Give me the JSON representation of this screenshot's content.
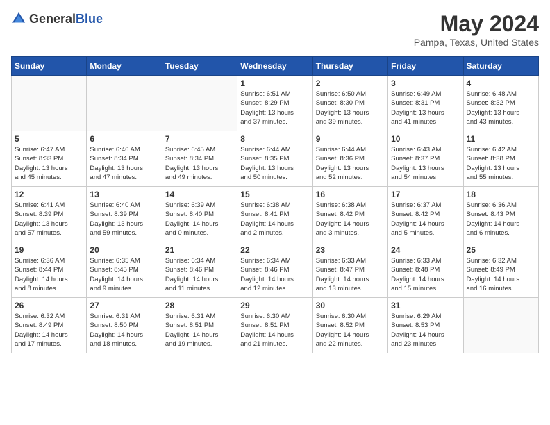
{
  "header": {
    "logo_general": "General",
    "logo_blue": "Blue",
    "month_year": "May 2024",
    "location": "Pampa, Texas, United States"
  },
  "days_of_week": [
    "Sunday",
    "Monday",
    "Tuesday",
    "Wednesday",
    "Thursday",
    "Friday",
    "Saturday"
  ],
  "weeks": [
    [
      {
        "day": "",
        "info": ""
      },
      {
        "day": "",
        "info": ""
      },
      {
        "day": "",
        "info": ""
      },
      {
        "day": "1",
        "info": "Sunrise: 6:51 AM\nSunset: 8:29 PM\nDaylight: 13 hours\nand 37 minutes."
      },
      {
        "day": "2",
        "info": "Sunrise: 6:50 AM\nSunset: 8:30 PM\nDaylight: 13 hours\nand 39 minutes."
      },
      {
        "day": "3",
        "info": "Sunrise: 6:49 AM\nSunset: 8:31 PM\nDaylight: 13 hours\nand 41 minutes."
      },
      {
        "day": "4",
        "info": "Sunrise: 6:48 AM\nSunset: 8:32 PM\nDaylight: 13 hours\nand 43 minutes."
      }
    ],
    [
      {
        "day": "5",
        "info": "Sunrise: 6:47 AM\nSunset: 8:33 PM\nDaylight: 13 hours\nand 45 minutes."
      },
      {
        "day": "6",
        "info": "Sunrise: 6:46 AM\nSunset: 8:34 PM\nDaylight: 13 hours\nand 47 minutes."
      },
      {
        "day": "7",
        "info": "Sunrise: 6:45 AM\nSunset: 8:34 PM\nDaylight: 13 hours\nand 49 minutes."
      },
      {
        "day": "8",
        "info": "Sunrise: 6:44 AM\nSunset: 8:35 PM\nDaylight: 13 hours\nand 50 minutes."
      },
      {
        "day": "9",
        "info": "Sunrise: 6:44 AM\nSunset: 8:36 PM\nDaylight: 13 hours\nand 52 minutes."
      },
      {
        "day": "10",
        "info": "Sunrise: 6:43 AM\nSunset: 8:37 PM\nDaylight: 13 hours\nand 54 minutes."
      },
      {
        "day": "11",
        "info": "Sunrise: 6:42 AM\nSunset: 8:38 PM\nDaylight: 13 hours\nand 55 minutes."
      }
    ],
    [
      {
        "day": "12",
        "info": "Sunrise: 6:41 AM\nSunset: 8:39 PM\nDaylight: 13 hours\nand 57 minutes."
      },
      {
        "day": "13",
        "info": "Sunrise: 6:40 AM\nSunset: 8:39 PM\nDaylight: 13 hours\nand 59 minutes."
      },
      {
        "day": "14",
        "info": "Sunrise: 6:39 AM\nSunset: 8:40 PM\nDaylight: 14 hours\nand 0 minutes."
      },
      {
        "day": "15",
        "info": "Sunrise: 6:38 AM\nSunset: 8:41 PM\nDaylight: 14 hours\nand 2 minutes."
      },
      {
        "day": "16",
        "info": "Sunrise: 6:38 AM\nSunset: 8:42 PM\nDaylight: 14 hours\nand 3 minutes."
      },
      {
        "day": "17",
        "info": "Sunrise: 6:37 AM\nSunset: 8:42 PM\nDaylight: 14 hours\nand 5 minutes."
      },
      {
        "day": "18",
        "info": "Sunrise: 6:36 AM\nSunset: 8:43 PM\nDaylight: 14 hours\nand 6 minutes."
      }
    ],
    [
      {
        "day": "19",
        "info": "Sunrise: 6:36 AM\nSunset: 8:44 PM\nDaylight: 14 hours\nand 8 minutes."
      },
      {
        "day": "20",
        "info": "Sunrise: 6:35 AM\nSunset: 8:45 PM\nDaylight: 14 hours\nand 9 minutes."
      },
      {
        "day": "21",
        "info": "Sunrise: 6:34 AM\nSunset: 8:46 PM\nDaylight: 14 hours\nand 11 minutes."
      },
      {
        "day": "22",
        "info": "Sunrise: 6:34 AM\nSunset: 8:46 PM\nDaylight: 14 hours\nand 12 minutes."
      },
      {
        "day": "23",
        "info": "Sunrise: 6:33 AM\nSunset: 8:47 PM\nDaylight: 14 hours\nand 13 minutes."
      },
      {
        "day": "24",
        "info": "Sunrise: 6:33 AM\nSunset: 8:48 PM\nDaylight: 14 hours\nand 15 minutes."
      },
      {
        "day": "25",
        "info": "Sunrise: 6:32 AM\nSunset: 8:49 PM\nDaylight: 14 hours\nand 16 minutes."
      }
    ],
    [
      {
        "day": "26",
        "info": "Sunrise: 6:32 AM\nSunset: 8:49 PM\nDaylight: 14 hours\nand 17 minutes."
      },
      {
        "day": "27",
        "info": "Sunrise: 6:31 AM\nSunset: 8:50 PM\nDaylight: 14 hours\nand 18 minutes."
      },
      {
        "day": "28",
        "info": "Sunrise: 6:31 AM\nSunset: 8:51 PM\nDaylight: 14 hours\nand 19 minutes."
      },
      {
        "day": "29",
        "info": "Sunrise: 6:30 AM\nSunset: 8:51 PM\nDaylight: 14 hours\nand 21 minutes."
      },
      {
        "day": "30",
        "info": "Sunrise: 6:30 AM\nSunset: 8:52 PM\nDaylight: 14 hours\nand 22 minutes."
      },
      {
        "day": "31",
        "info": "Sunrise: 6:29 AM\nSunset: 8:53 PM\nDaylight: 14 hours\nand 23 minutes."
      },
      {
        "day": "",
        "info": ""
      }
    ]
  ]
}
